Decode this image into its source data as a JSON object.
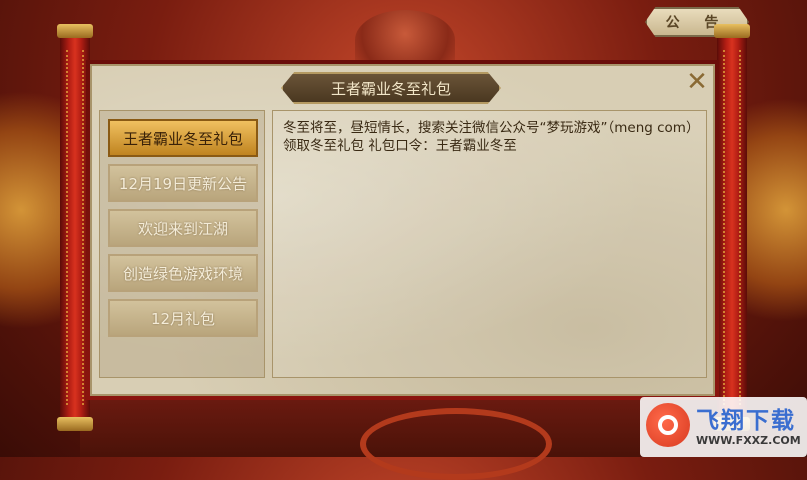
{
  "notice_tab": {
    "label": "公 告"
  },
  "dialog": {
    "title": "王者霸业冬至礼包",
    "close_icon": "close-x-icon"
  },
  "tabs": [
    {
      "label": "王者霸业冬至礼包",
      "active": true
    },
    {
      "label": "12月19日更新公告",
      "active": false
    },
    {
      "label": "欢迎来到江湖",
      "active": false
    },
    {
      "label": "创造绿色游戏环境",
      "active": false
    },
    {
      "label": "12月礼包",
      "active": false
    }
  ],
  "content": {
    "text": "冬至将至，昼短情长，搜索关注微信公众号“梦玩游戏”（meng com）领取冬至礼包 礼包口令：王者霸业冬至"
  },
  "watermark": {
    "name": "飞翔下载",
    "url": "WWW.FXXZ.COM"
  },
  "colors": {
    "active_tab": "#c08420",
    "parchment": "#d8ceb4",
    "roller_red": "#b31e14"
  }
}
